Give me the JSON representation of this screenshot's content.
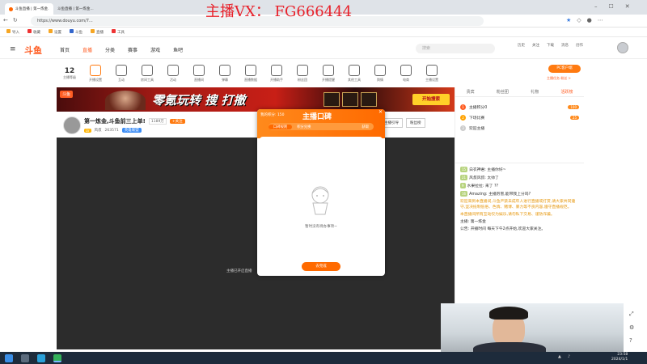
{
  "watermark": "主播VX： FG666444",
  "browser": {
    "tabs": [
      "斗鱼直播 | 第一炼金...",
      "斗鱼直播 | 第一炼金..."
    ],
    "url": "https://www.douyu.com/7..."
  },
  "site": {
    "nav": [
      "首页",
      "直播",
      "分类",
      "赛事",
      "游戏",
      "鱼吧"
    ],
    "active_nav": "直播",
    "search_placeholder": "搜索",
    "header_icons": [
      "历史",
      "关注",
      "下载",
      "消息",
      "创作"
    ],
    "pc_client": "PC客户端",
    "level": "12",
    "level_label": "主播等级"
  },
  "toolbar": {
    "items": [
      "开播设置",
      "互动",
      "房间工具",
      "活动",
      "直播间",
      "弹幕",
      "直播数据",
      "开播助手",
      "粉丝团",
      "开播提醒",
      "其他工具",
      "舆情",
      "电商",
      "主播设置"
    ],
    "right_label": "主播任务 粉丝 >"
  },
  "banner": {
    "left_badge": "斗鱼",
    "headline": "零氪玩转 搜 打撤",
    "right_button": "开始搜索"
  },
  "stream": {
    "title": "第一炼金,斗鱼前三上单!",
    "badge_count": "1189万",
    "follow_label": "+关注",
    "streamer": "风叔",
    "followers": "263571",
    "tag": "英雄联盟",
    "guide": "主播引导",
    "fans_btn": "粉丝榜",
    "video_caption": "主播已开启直播"
  },
  "popup": {
    "points": "我的积分: 150",
    "title": "主播口碑",
    "tab_active": "口碑规则",
    "tab2": "积分兑换",
    "tab3": "获取",
    "empty_text": "暂时没有待办事项~",
    "button": "去完成"
  },
  "chat": {
    "tabs": [
      "贵宾",
      "粉丝团",
      "礼物",
      "活跃榜"
    ],
    "ranks": [
      {
        "num": "1",
        "name": "主播积分0",
        "badge": "100"
      },
      {
        "num": "2",
        "name": "下场比赛",
        "badge": "25"
      },
      {
        "num": "3",
        "name": "欢迎主播"
      }
    ],
    "messages": [
      {
        "lv": "15",
        "text": "白衣神君: 主播你好~"
      },
      {
        "lv": "21",
        "text": "风叔风叔: 太帅了"
      },
      {
        "lv": "9",
        "text": "水果拉拉: 来了 ??"
      },
      {
        "lv": "16",
        "text": "Amazing: 主播厉害,能带我上分吗?"
      },
      {
        "lv": "",
        "text": "欢迎来到本直播间,斗鱼严禁未成年人进行直播或打赏,请大家共同遵守,坚决抵制低俗、色情、赌博、暴力等不良内容,遵守直播规范。"
      },
      {
        "lv": "",
        "text": "本直播间所有互动仅为娱乐,请勿私下交易、谨防诈骗。"
      },
      {
        "lv": "",
        "text": "主播: 第一炼金"
      },
      {
        "lv": "",
        "text": "公告: 开播时间 每天下午2点开始,欢迎大家关注。"
      }
    ]
  },
  "taskbar": {
    "time": "23:58",
    "date": "2024/1/1"
  },
  "colors": {
    "brand": "#ff5d23",
    "banner": "#c81f16",
    "popup_head": "#ff7a10"
  }
}
